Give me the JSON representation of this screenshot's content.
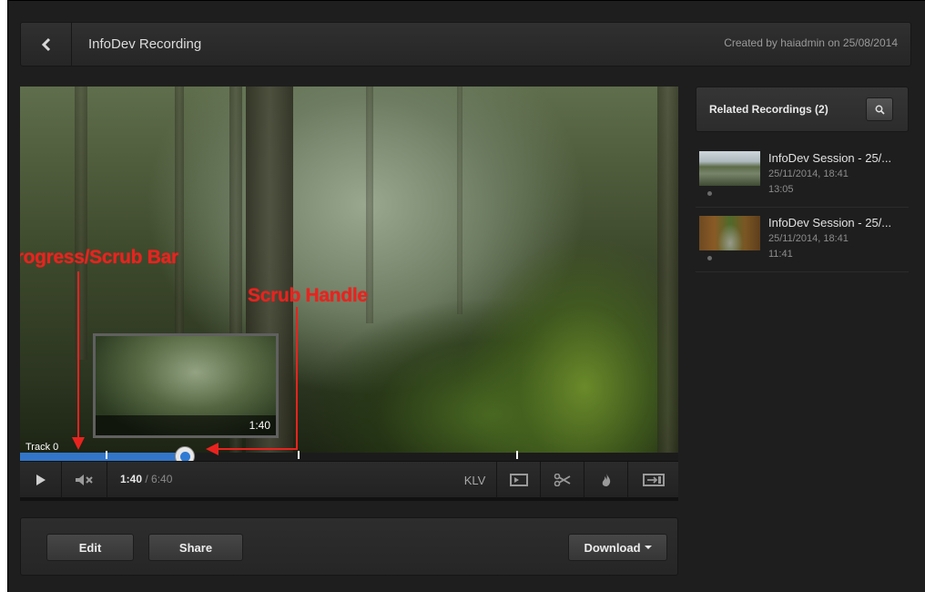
{
  "header": {
    "title": "InfoDev Recording",
    "meta": "Created by haiadmin on 25/08/2014"
  },
  "player": {
    "track_label": "Track 0",
    "preview_time": "1:40",
    "current_time": "1:40",
    "separator": " / ",
    "duration": "6:40",
    "progress_fraction": 0.25,
    "klv_label": "KLV"
  },
  "annotations": {
    "progress_bar": "Progress/Scrub Bar",
    "scrub_handle": "Scrub Handle"
  },
  "actions": {
    "edit": "Edit",
    "share": "Share",
    "download": "Download"
  },
  "sidebar": {
    "title": "Related Recordings (2)",
    "items": [
      {
        "title": "InfoDev Session - 25/...",
        "date": "25/11/2014, 18:41",
        "duration": "13:05"
      },
      {
        "title": "InfoDev Session - 25/...",
        "date": "25/11/2014, 18:41",
        "duration": "11:41"
      }
    ]
  },
  "icons": {
    "back": "chevron-left-icon",
    "play": "play-icon",
    "mute": "mute-icon",
    "clip": "clip-icon",
    "cut": "scissors-icon",
    "burn": "flame-icon",
    "export": "export-icon",
    "search": "search-icon"
  },
  "colors": {
    "accent": "#3376c9",
    "annotation": "#e8231f",
    "background": "#1e1e1e"
  }
}
